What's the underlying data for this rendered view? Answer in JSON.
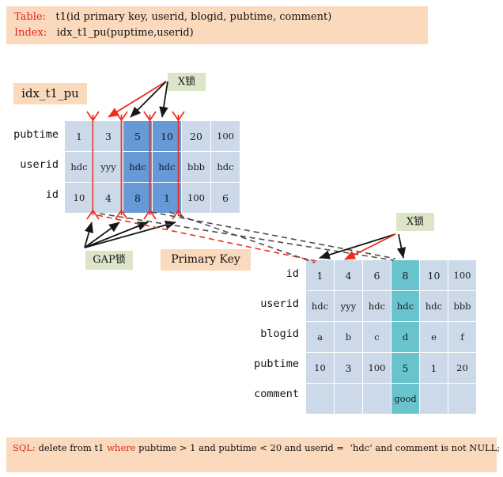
{
  "header": {
    "table_keyword": "Table:",
    "table_def": "   t1(id primary key, userid, blogid, pubtime, comment)",
    "index_keyword": "Index:",
    "index_def": "   idx_t1_pu(puptime,userid)"
  },
  "labels": {
    "index_name": "idx_t1_pu",
    "xlock_1": "X锁",
    "xlock_2": "X锁",
    "gap_lock": "GAP锁",
    "primary_key": "Primary Key"
  },
  "index_table": {
    "row_labels": [
      "pubtime",
      "userid",
      "id"
    ],
    "columns": 6,
    "rows": [
      [
        "1",
        "3",
        "5",
        "10",
        "20",
        "100"
      ],
      [
        "hdc",
        "yyy",
        "hdc",
        "hdc",
        "bbb",
        "hdc"
      ],
      [
        "10",
        "4",
        "8",
        "1",
        "100",
        "6"
      ]
    ],
    "highlighted_columns": [
      2,
      3
    ],
    "highlight_color": "#6699d6",
    "cell_color": "#ccd9e8"
  },
  "primary_table": {
    "row_labels": [
      "id",
      "userid",
      "blogid",
      "pubtime",
      "comment"
    ],
    "columns": 6,
    "rows": [
      [
        "1",
        "4",
        "6",
        "8",
        "10",
        "100"
      ],
      [
        "hdc",
        "yyy",
        "hdc",
        "hdc",
        "hdc",
        "bbb"
      ],
      [
        "a",
        "b",
        "c",
        "d",
        "e",
        "f"
      ],
      [
        "10",
        "3",
        "100",
        "5",
        "1",
        "20"
      ],
      [
        "",
        "",
        "",
        "good",
        "",
        ""
      ]
    ],
    "highlighted_columns": [
      3
    ],
    "highlight_color": "#69c3cc",
    "cell_color": "#ccd9e8"
  },
  "sql": {
    "prefix": "SQL:",
    "part1": " delete from t1 ",
    "part2": "where",
    "part3": " pubtime > 1 and pubtime < 20 and userid =  ‘hdc’ and comment is not NULL;"
  },
  "colors": {
    "banner_orange": "#fad9bd",
    "tag_green": "#dde5c8",
    "keyword_red": "#e8241e",
    "sql_red": "#d92b1c",
    "gap_line_red": "#f02b1a",
    "arrow_black": "#161616",
    "dashed_gray": "#4d4d4d"
  }
}
